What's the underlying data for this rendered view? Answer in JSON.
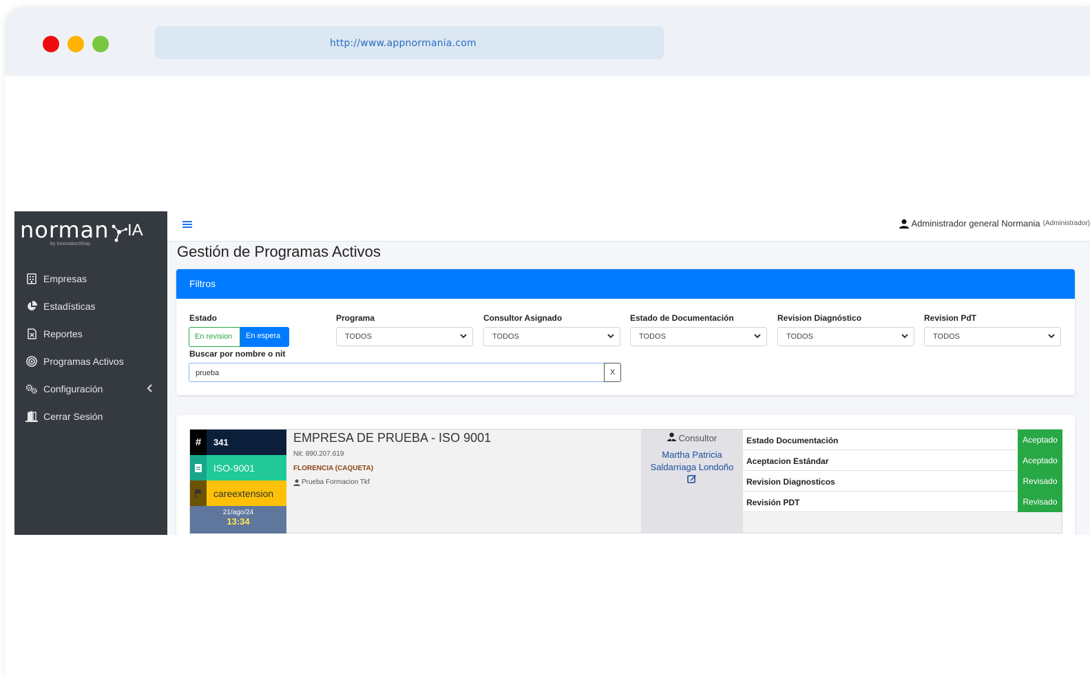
{
  "browser": {
    "url": "http://www.appnormania.com"
  },
  "brand": {
    "name": "norman",
    "suffix": "IA",
    "tagline": "by InnovationShop"
  },
  "sidebar": {
    "items": [
      {
        "label": "Empresas",
        "icon": "building-icon"
      },
      {
        "label": "Estadísticas",
        "icon": "pie-chart-icon"
      },
      {
        "label": "Reportes",
        "icon": "file-excel-icon"
      },
      {
        "label": "Programas Activos",
        "icon": "target-icon"
      },
      {
        "label": "Configuración",
        "icon": "cogs-icon"
      },
      {
        "label": "Cerrar Sesión",
        "icon": "door-exit-icon"
      }
    ]
  },
  "header": {
    "user_name": "Administrador general Normania",
    "user_role": "(Administrador)"
  },
  "page": {
    "title": "Gestión de Programas Activos"
  },
  "filters": {
    "title": "Filtros",
    "estado_label": "Estado",
    "estado_options": [
      "En revision",
      "En espera"
    ],
    "programa_label": "Programa",
    "programa_value": "TODOS",
    "consultor_label": "Consultor Asignado",
    "consultor_value": "TODOS",
    "documentacion_label": "Estado de Documentación",
    "documentacion_value": "TODOS",
    "diagnostico_label": "Revision Diagnóstico",
    "diagnostico_value": "TODOS",
    "pdt_label": "Revision PdT",
    "pdt_value": "TODOS",
    "search_label": "Buscar por nombre o nit",
    "search_value": "prueba",
    "clear_label": "X"
  },
  "result": {
    "id_symbol": "#",
    "id": "341",
    "program": "ISO-9001",
    "tag": "careextension",
    "date": "21/ago/24",
    "time": "13:34",
    "company": "EMPRESA DE PRUEBA - ISO 9001",
    "nit": "Nit: 890.207.619",
    "city": "FLORENCIA (CAQUETA)",
    "contact": "Prueba Formacion Tkf",
    "consultor_label": "Consultor",
    "consultor_name": "Martha Patricia Saldarriaga Londoño",
    "statuses": [
      {
        "label": "Estado Documentación",
        "value": "Aceptado"
      },
      {
        "label": "Aceptacion Estándar",
        "value": "Aceptado"
      },
      {
        "label": "Revision Diagnosticos",
        "value": "Revisado"
      },
      {
        "label": "Revisión PDT",
        "value": "Revisado"
      }
    ]
  },
  "colors": {
    "primary": "#007bff",
    "sidebar": "#343a40",
    "success": "#28a745",
    "iso": "#20c997",
    "warning": "#ffc107",
    "date_bg": "#5f779d"
  }
}
